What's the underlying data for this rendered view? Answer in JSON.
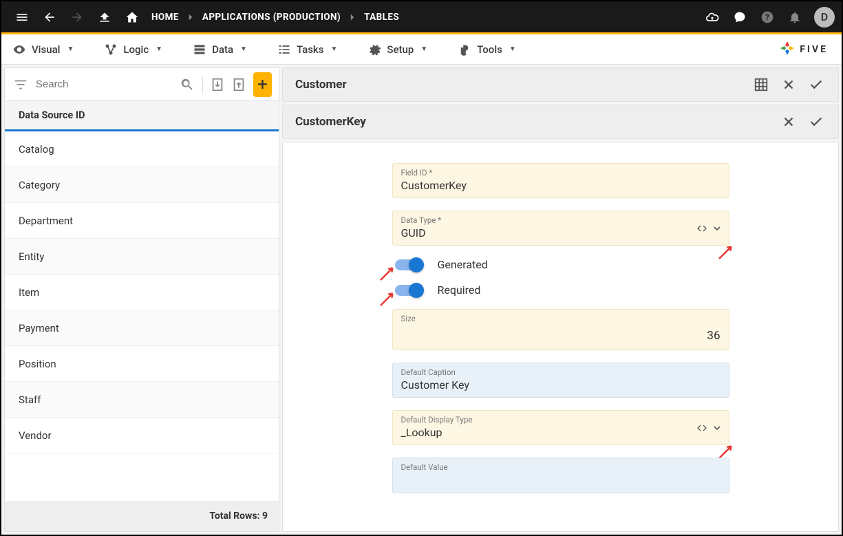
{
  "topbar": {
    "home": "HOME",
    "crumb1": "APPLICATIONS (PRODUCTION)",
    "crumb2": "TABLES",
    "avatar": "D"
  },
  "menu": {
    "visual": "Visual",
    "logic": "Logic",
    "data": "Data",
    "tasks": "Tasks",
    "setup": "Setup",
    "tools": "Tools",
    "brand": "FIVE"
  },
  "sidebar": {
    "search_placeholder": "Search",
    "column_header": "Data Source ID",
    "items": [
      "Catalog",
      "Category",
      "Department",
      "Entity",
      "Item",
      "Payment",
      "Position",
      "Staff",
      "Vendor"
    ],
    "footer_label": "Total Rows:",
    "footer_count": "9"
  },
  "panel": {
    "title1": "Customer",
    "title2": "CustomerKey"
  },
  "form": {
    "field_id_label": "Field ID *",
    "field_id_value": "CustomerKey",
    "data_type_label": "Data Type *",
    "data_type_value": "GUID",
    "generated_label": "Generated",
    "required_label": "Required",
    "size_label": "Size",
    "size_value": "36",
    "caption_label": "Default Caption",
    "caption_value": "Customer Key",
    "display_label": "Default Display Type",
    "display_value": "_Lookup",
    "default_value_label": "Default Value",
    "default_value_value": ""
  }
}
